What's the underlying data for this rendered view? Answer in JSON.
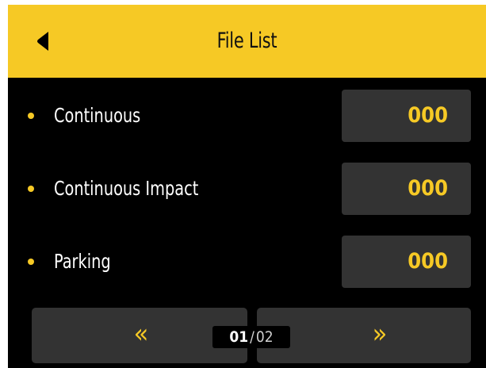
{
  "header": {
    "title": "File List",
    "back_icon": "back-arrow-icon"
  },
  "colors": {
    "accent": "#f6c925",
    "background": "#000000",
    "tile": "#333333"
  },
  "rows": [
    {
      "label": "Continuous",
      "count": "000"
    },
    {
      "label": "Continuous Impact",
      "count": "000"
    },
    {
      "label": "Parking",
      "count": "000"
    }
  ],
  "pagination": {
    "prev_glyph": "«",
    "next_glyph": "»",
    "current": "01",
    "separator": "/",
    "total": "02"
  }
}
